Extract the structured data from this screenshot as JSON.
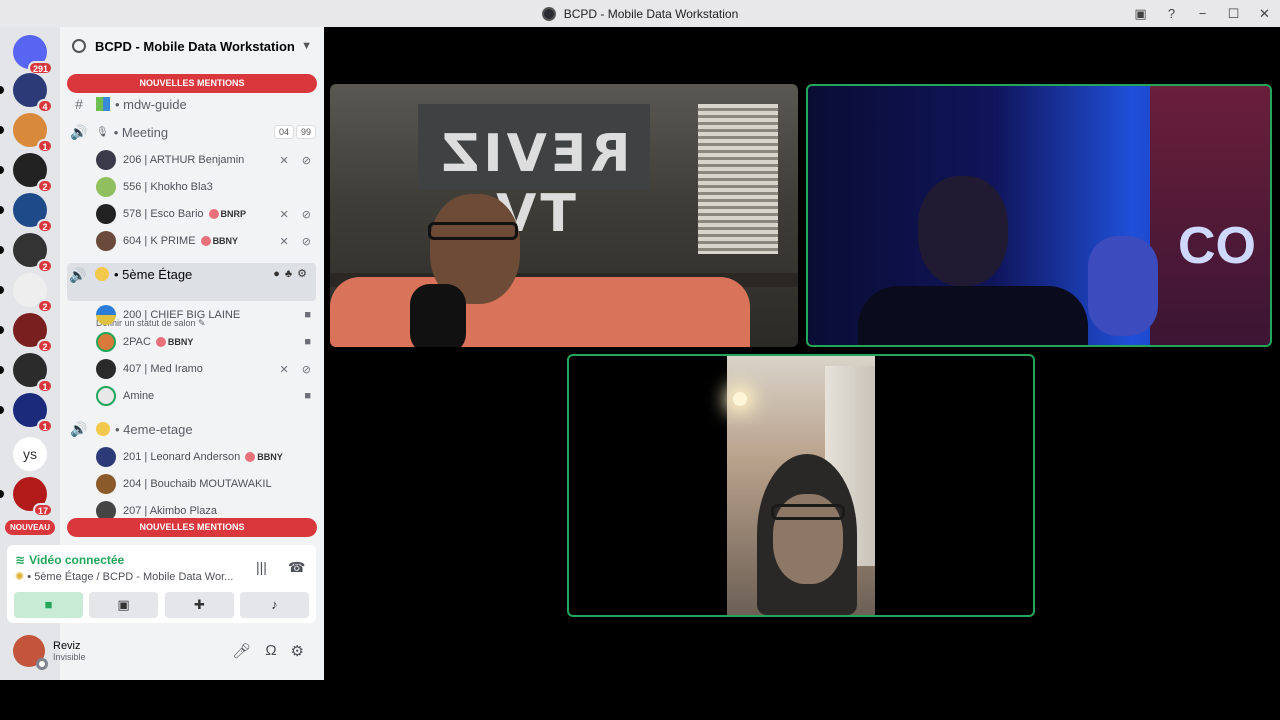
{
  "window": {
    "title": "BCPD - Mobile Data Workstation",
    "controls": [
      "−",
      "☐",
      "✕"
    ]
  },
  "guilds": {
    "badges": [
      "291",
      "4",
      "1",
      "2",
      "2",
      "2",
      "2",
      "2",
      "1",
      "1",
      "17"
    ],
    "text_guild": "ys",
    "new_label": "NOUVEAU"
  },
  "server": {
    "name": "BCPD - Mobile Data Workstation",
    "mention_banner": "NOUVELLES MENTIONS"
  },
  "channels": {
    "mdw_guide": "mdw-guide",
    "meeting": {
      "name": "Meeting",
      "count_a": "04",
      "count_b": "99",
      "users": [
        {
          "name": "206 | ARTHUR Benjamin",
          "tag": "",
          "icons": "✕ ⊘"
        },
        {
          "name": "556 | Khokho Bla3",
          "tag": "",
          "icons": ""
        },
        {
          "name": "578 | Esco Bario",
          "tag": "BNRP",
          "icons": "✕ ⊘"
        },
        {
          "name": "604 | K PRIME",
          "tag": "BBNY",
          "icons": "✕ ⊘"
        }
      ]
    },
    "etage5": {
      "name": "5ème Étage",
      "status": "Définir un statut de salon ✎",
      "users": [
        {
          "name": "200 | CHIEF BIG LAINE",
          "tag": "",
          "icons": "■"
        },
        {
          "name": "2PAC",
          "tag": "BBNY",
          "icons": "■"
        },
        {
          "name": "407 | Med Iramo",
          "tag": "",
          "icons": "✕ ⊘"
        },
        {
          "name": "Amine",
          "tag": "",
          "icons": "■"
        }
      ]
    },
    "etage4": {
      "name": "4eme-etage",
      "users": [
        {
          "name": "201 | Leonard Anderson",
          "tag": "BBNY",
          "icons": ""
        },
        {
          "name": "204 | Bouchaib MOUTAWAKIL",
          "tag": "",
          "icons": ""
        },
        {
          "name": "207 | Akimbo Plaza",
          "tag": "",
          "icons": ""
        }
      ]
    }
  },
  "voice": {
    "title": "Vidéo connectée",
    "subtitle": "5ème Étage / BCPD - Mobile Data Wor..."
  },
  "user": {
    "name": "Reviz",
    "status": "Invisible"
  },
  "stream": {
    "banner_text": "REVIZ TV",
    "flag_text": "CO"
  },
  "colors": {
    "speaking": "#23a55a",
    "mention": "#da373c"
  }
}
